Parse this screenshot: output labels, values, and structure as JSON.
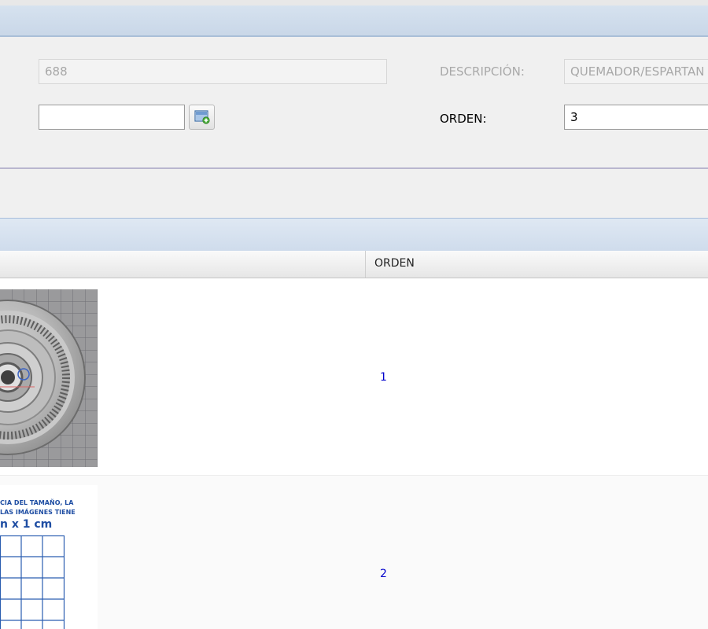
{
  "form": {
    "code_value": "688",
    "description_label": "DESCRIPCIÓN:",
    "description_value": "QUEMADOR/ESPARTAN",
    "file_value": "",
    "order_label": "ORDEN:",
    "order_value": "3"
  },
  "grid": {
    "columns": [
      "",
      "ORDEN"
    ],
    "rows": [
      {
        "image": "burner-photo",
        "orden": "1"
      },
      {
        "image": "size-reference-grid",
        "caption_line1": "CIA DEL TAMAÑO, LA",
        "caption_line2": "LAS IMÁGENES TIENE",
        "caption_line3": "n x 1 cm",
        "orden": "2"
      }
    ]
  },
  "colors": {
    "header_blue": "#c9d7e8",
    "link_blue": "#0000cc",
    "caption_blue": "#1f4ea3"
  }
}
